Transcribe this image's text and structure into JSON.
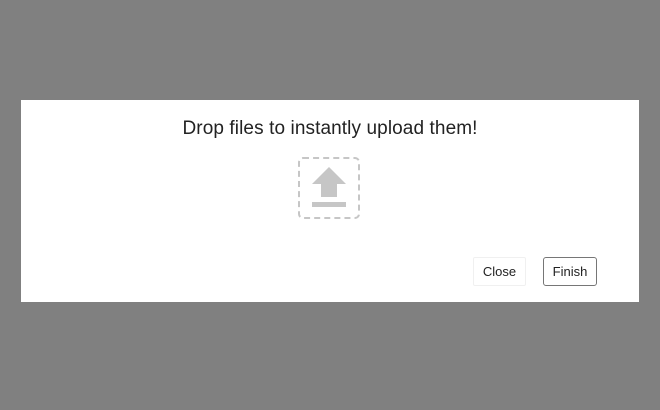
{
  "dialog": {
    "title": "Drop files to instantly upload them!",
    "upload_icon": "upload-arrow-icon",
    "buttons": {
      "close_label": "Close",
      "finish_label": "Finish"
    }
  },
  "colors": {
    "overlay": "#808080",
    "dialog_background": "#ffffff",
    "icon_gray": "#c6c6c6",
    "text": "#222222",
    "finish_border": "#767676"
  }
}
